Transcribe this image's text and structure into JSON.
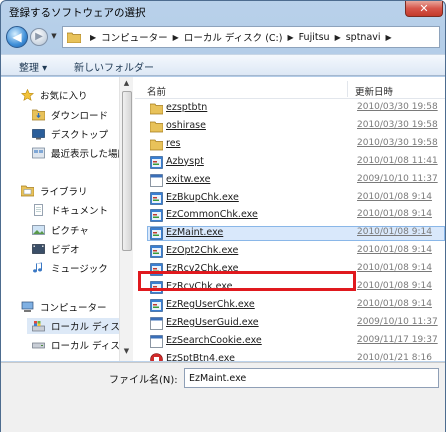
{
  "window": {
    "title": "登録するソフトウェアの選択",
    "close_glyph": "✕"
  },
  "nav_bar": {
    "back_glyph": "◀",
    "forward_glyph": "▶",
    "history_glyph": "▼",
    "breadcrumb": [
      "コンピューター",
      "ローカル ディスク (C:)",
      "Fujitsu",
      "sptnavi"
    ],
    "separator": "▶"
  },
  "toolbar": {
    "organize_label": "整理 ▾",
    "new_folder_label": "新しいフォルダー"
  },
  "nav_pane": {
    "favorites": "お気に入り",
    "favorites_items": [
      "ダウンロード",
      "デスクトップ",
      "最近表示した場所"
    ],
    "libraries": "ライブラリ",
    "libraries_items": [
      "ドキュメント",
      "ピクチャ",
      "ビデオ",
      "ミュージック"
    ],
    "computer": "コンピューター",
    "computer_items": [
      "ローカル ディスク",
      "ローカル ディスク"
    ],
    "scroll_up": "▲",
    "scroll_down": "▼"
  },
  "file_list": {
    "col_name": "名前",
    "col_date": "更新日時",
    "rows": [
      {
        "name": "ezsptbtn",
        "date": "2010/03/30 19:58",
        "icon": "folder-icon"
      },
      {
        "name": "oshirase",
        "date": "2010/03/30 19:58",
        "icon": "folder-icon"
      },
      {
        "name": "res",
        "date": "2010/03/30 19:58",
        "icon": "folder-icon"
      },
      {
        "name": "Azbyspt",
        "date": "2010/01/08 11:41",
        "icon": "app-icon"
      },
      {
        "name": "exitw.exe",
        "date": "2009/10/10 11:37",
        "icon": "exe-icon"
      },
      {
        "name": "EzBkupChk.exe",
        "date": "2010/01/08 9:14",
        "icon": "app-icon"
      },
      {
        "name": "EzCommonChk.exe",
        "date": "2010/01/08 9:14",
        "icon": "app-icon"
      },
      {
        "name": "EzMaint.exe",
        "date": "2010/01/08 9:14",
        "icon": "app-icon"
      },
      {
        "name": "EzOpt2Chk.exe",
        "date": "2010/01/08 9:14",
        "icon": "app-icon"
      },
      {
        "name": "EzRcv2Chk.exe",
        "date": "2010/01/08 9:14",
        "icon": "app-icon"
      },
      {
        "name": "EzRcvChk.exe",
        "date": "2010/01/08 9:14",
        "icon": "app-icon"
      },
      {
        "name": "EzRegUserChk.exe",
        "date": "2010/01/08 9:14",
        "icon": "app-icon"
      },
      {
        "name": "EzRegUserGuid.exe",
        "date": "2009/10/10 11:37",
        "icon": "exe-icon"
      },
      {
        "name": "EzSearchCookie.exe",
        "date": "2009/11/17 19:37",
        "icon": "exe-icon"
      },
      {
        "name": "EzSptBtn4.exe",
        "date": "2010/01/21 8:16",
        "icon": "red-app-icon"
      }
    ],
    "selected_index": 7
  },
  "footer": {
    "filename_label": "ファイル名(N):",
    "filename_value": "EzMaint.exe"
  },
  "colors": {
    "highlight": "#e0191e",
    "selection": "#d9e8fb"
  }
}
